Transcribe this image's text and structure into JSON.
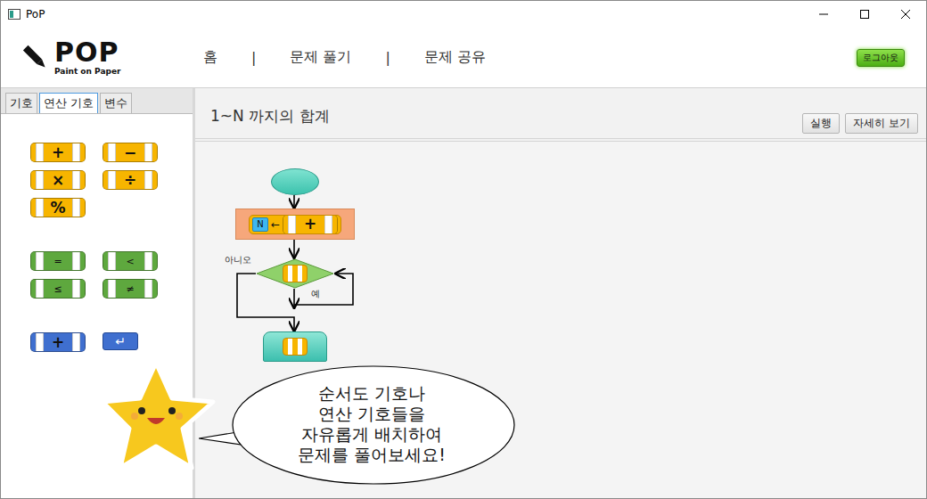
{
  "window": {
    "title": "PoP"
  },
  "logo": {
    "name": "POP",
    "tagline": "Paint on Paper"
  },
  "nav": {
    "items": [
      "홈",
      "문제 풀기",
      "문제 공유"
    ],
    "separator": "|"
  },
  "logout": "로그아웃",
  "sidebar": {
    "tabs": [
      {
        "label": "기호",
        "selected": false
      },
      {
        "label": "연산 기호",
        "selected": true
      },
      {
        "label": "변수",
        "selected": false
      }
    ],
    "groups": [
      {
        "color": "#f7b500",
        "items": [
          {
            "symbol": "+",
            "kind": "operator"
          },
          {
            "symbol": "−",
            "kind": "operator"
          },
          {
            "symbol": "×",
            "kind": "operator"
          },
          {
            "symbol": "÷",
            "kind": "operator"
          },
          {
            "symbol": "%",
            "kind": "operator"
          }
        ]
      },
      {
        "color": "#5ea83e",
        "items": [
          {
            "symbol": "=",
            "kind": "operator"
          },
          {
            "symbol": "<",
            "kind": "operator"
          },
          {
            "symbol": "≤",
            "kind": "operator"
          },
          {
            "symbol": "≠",
            "kind": "operator"
          }
        ]
      },
      {
        "color": "#3f6fcf",
        "items": [
          {
            "symbol": "+",
            "kind": "operator"
          },
          {
            "symbol": "↵",
            "kind": "key"
          }
        ]
      }
    ]
  },
  "problem": {
    "title": "1~N 까지의 합계",
    "buttons": [
      "실행",
      "자세히 보기"
    ]
  },
  "flowchart": {
    "process": {
      "target": "N",
      "arrow": "←",
      "operator": "+"
    },
    "decision": {
      "no": "아니오",
      "yes": "예"
    }
  },
  "bubble": {
    "lines": [
      "순서도 기호나",
      "연산 기호들을",
      "자유롭게 배치하여",
      "문제를 풀어보세요!"
    ]
  }
}
